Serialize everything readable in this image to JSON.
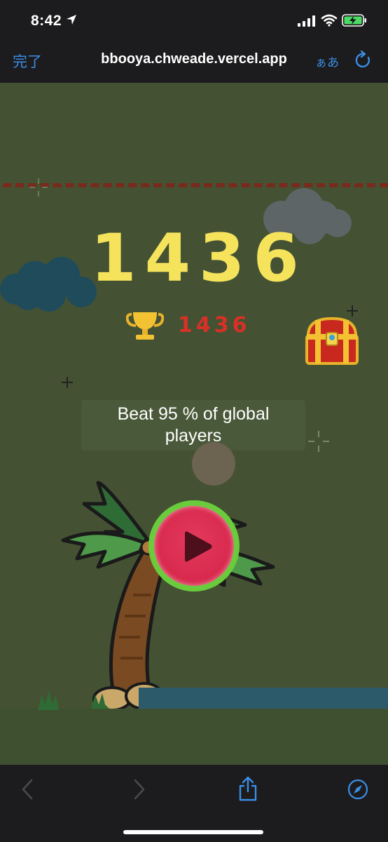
{
  "status_bar": {
    "time": "8:42"
  },
  "browser": {
    "done_label": "完了",
    "url": "bbooya.chweade.vercel.app",
    "text_size_label": "ぁあ"
  },
  "game": {
    "score": "1436",
    "best_score": "1436",
    "beat_text_line1": "Beat 95 % of global",
    "beat_text_line2": "players"
  },
  "colors": {
    "background": "#445233",
    "score": "#f5e35c",
    "best_score": "#d93025",
    "play_button": "#d8284c",
    "play_ring": "#6acc3c",
    "accent": "#3a8ee6"
  },
  "icons": [
    "location-arrow-icon",
    "signal-icon",
    "wifi-icon",
    "battery-charging-icon",
    "reload-icon",
    "trophy-icon",
    "treasure-chest-icon",
    "play-icon",
    "back-icon",
    "forward-icon",
    "share-icon",
    "compass-icon"
  ]
}
